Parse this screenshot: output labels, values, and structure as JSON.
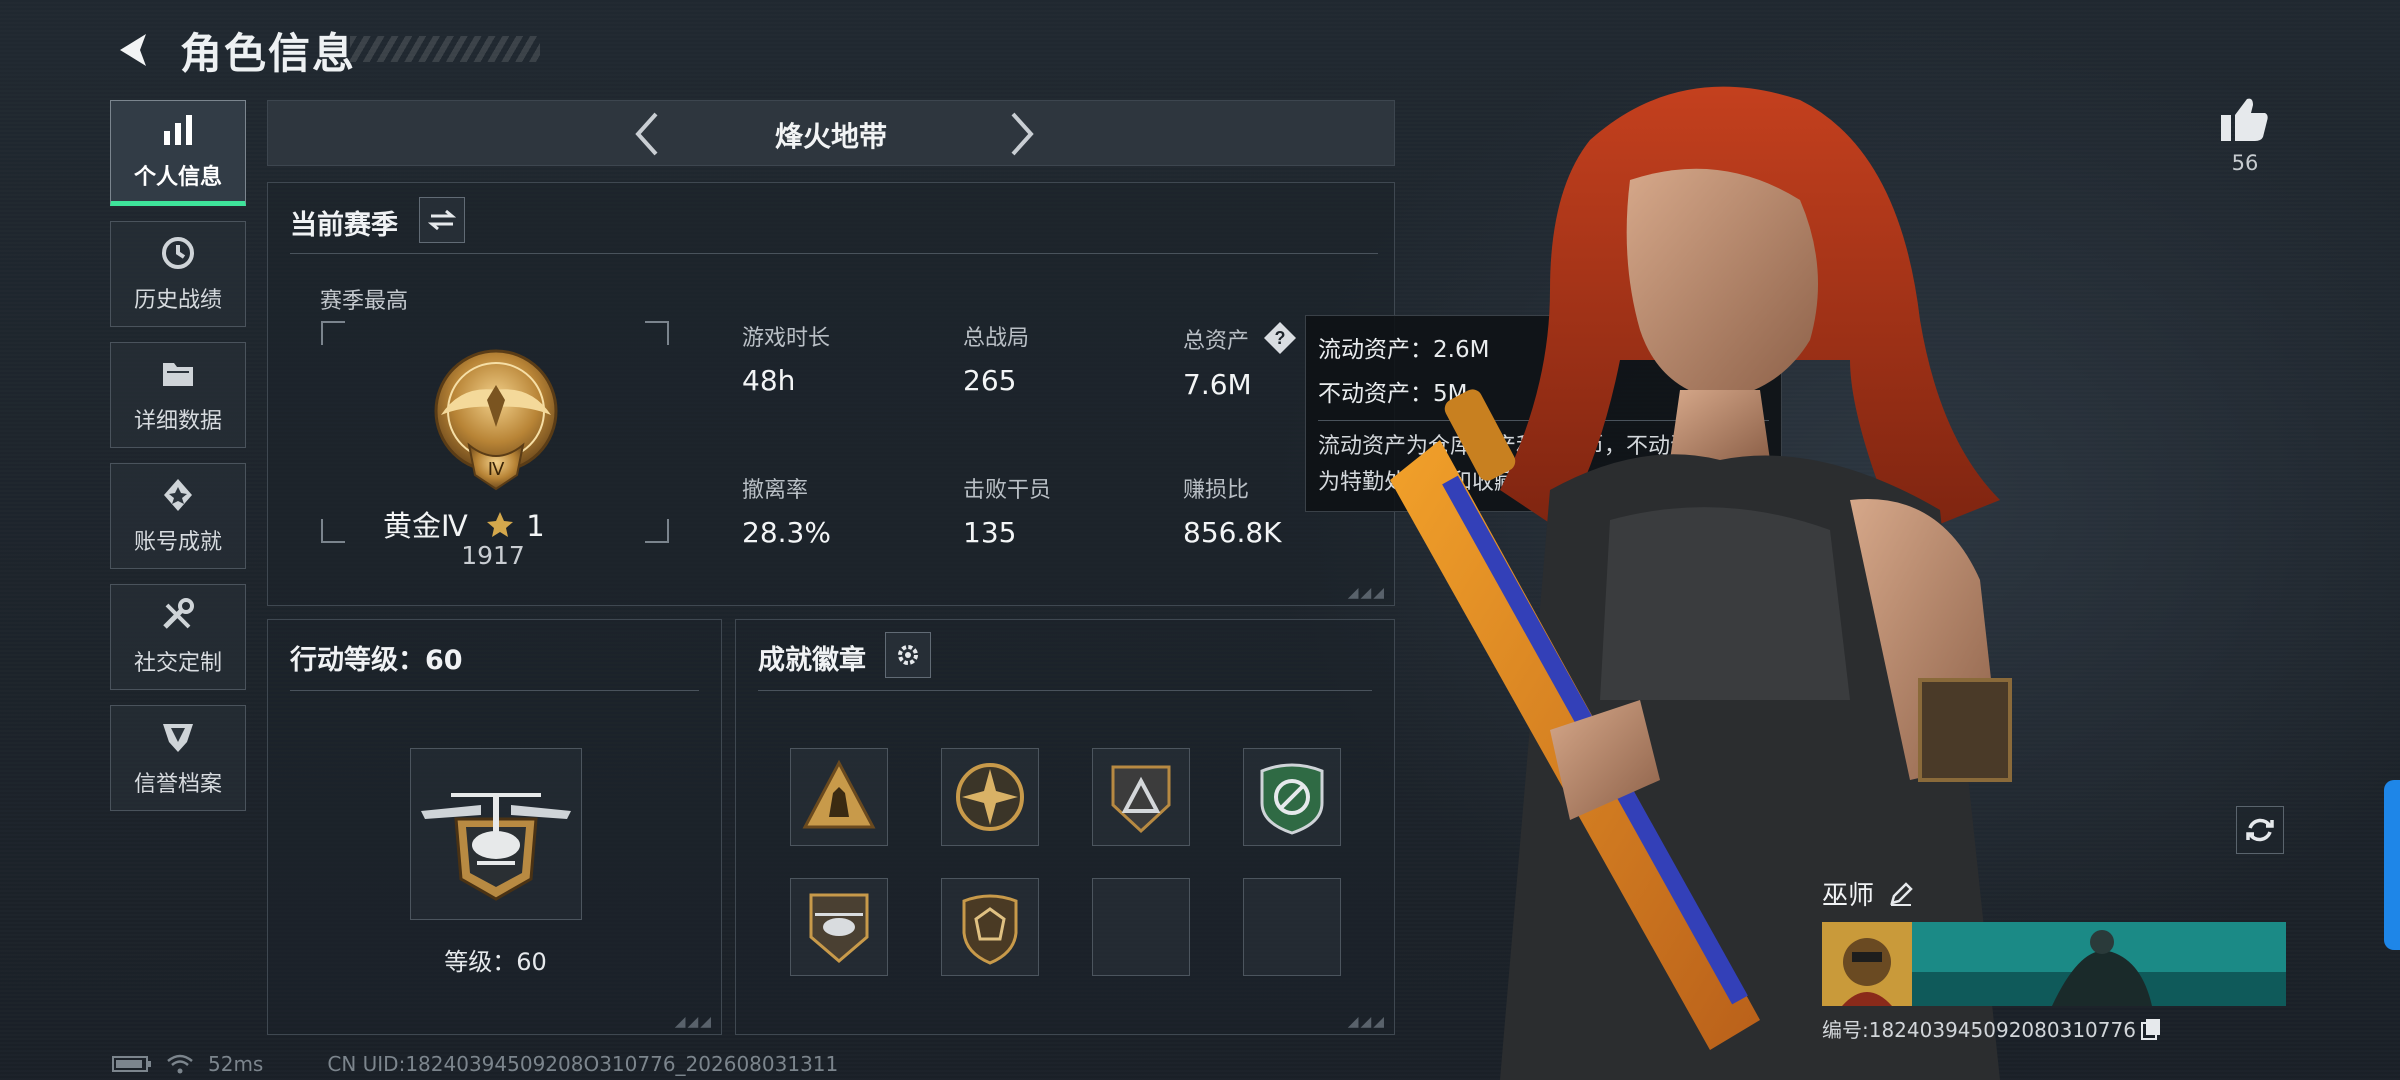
{
  "header": {
    "title": "角色信息"
  },
  "sidebar": {
    "items": [
      {
        "label": "个人信息",
        "icon": "bar-chart-icon",
        "active": true
      },
      {
        "label": "历史战绩",
        "icon": "history-clock-icon"
      },
      {
        "label": "详细数据",
        "icon": "folder-icon"
      },
      {
        "label": "账号成就",
        "icon": "achievement-icon"
      },
      {
        "label": "社交定制",
        "icon": "tools-icon"
      },
      {
        "label": "信誉档案",
        "icon": "reputation-shield-icon"
      }
    ]
  },
  "mode": {
    "title": "烽火地带"
  },
  "season": {
    "title": "当前赛季",
    "subtitle": "赛季最高",
    "rank_name": "黄金Ⅳ",
    "rank_badge_numeral": "Ⅳ",
    "rank_stars": "1",
    "rank_score": "1917",
    "stats": [
      {
        "label": "游戏时长",
        "value": "48h"
      },
      {
        "label": "总战局",
        "value": "265"
      },
      {
        "label": "总资产",
        "value": "7.6M"
      },
      {
        "label": "撤离率",
        "value": "28.3%"
      },
      {
        "label": "击败干员",
        "value": "135"
      },
      {
        "label": "赚损比",
        "value": "856.8K"
      }
    ]
  },
  "tooltip": {
    "liquid": "流动资产：2.6M",
    "fixed": "不动资产：5M",
    "desc_line1": "流动资产为仓库资产和哈夫币，不动资产",
    "desc_line2": "为特勤处设施和收藏室设施"
  },
  "level": {
    "title": "行动等级：60",
    "text": "等级：60"
  },
  "achievements": {
    "title": "成就徽章",
    "badges": [
      "triangle-soldiers-badge",
      "star-compass-badge",
      "triangle-shield-badge",
      "green-crest-badge",
      "helicopter-badge",
      "hexagon-gem-badge",
      "empty-slot",
      "empty-slot"
    ]
  },
  "footer": {
    "ping": "52ms",
    "uid": "CN UID:18240394509208O310776_202608031311"
  },
  "profile": {
    "likes": "56",
    "name": "巫师",
    "id": "编号:182403945092080310776"
  },
  "colors": {
    "accent": "#3ee39a",
    "gold": "#c89a4a",
    "blue_tab": "#1e86e8"
  }
}
